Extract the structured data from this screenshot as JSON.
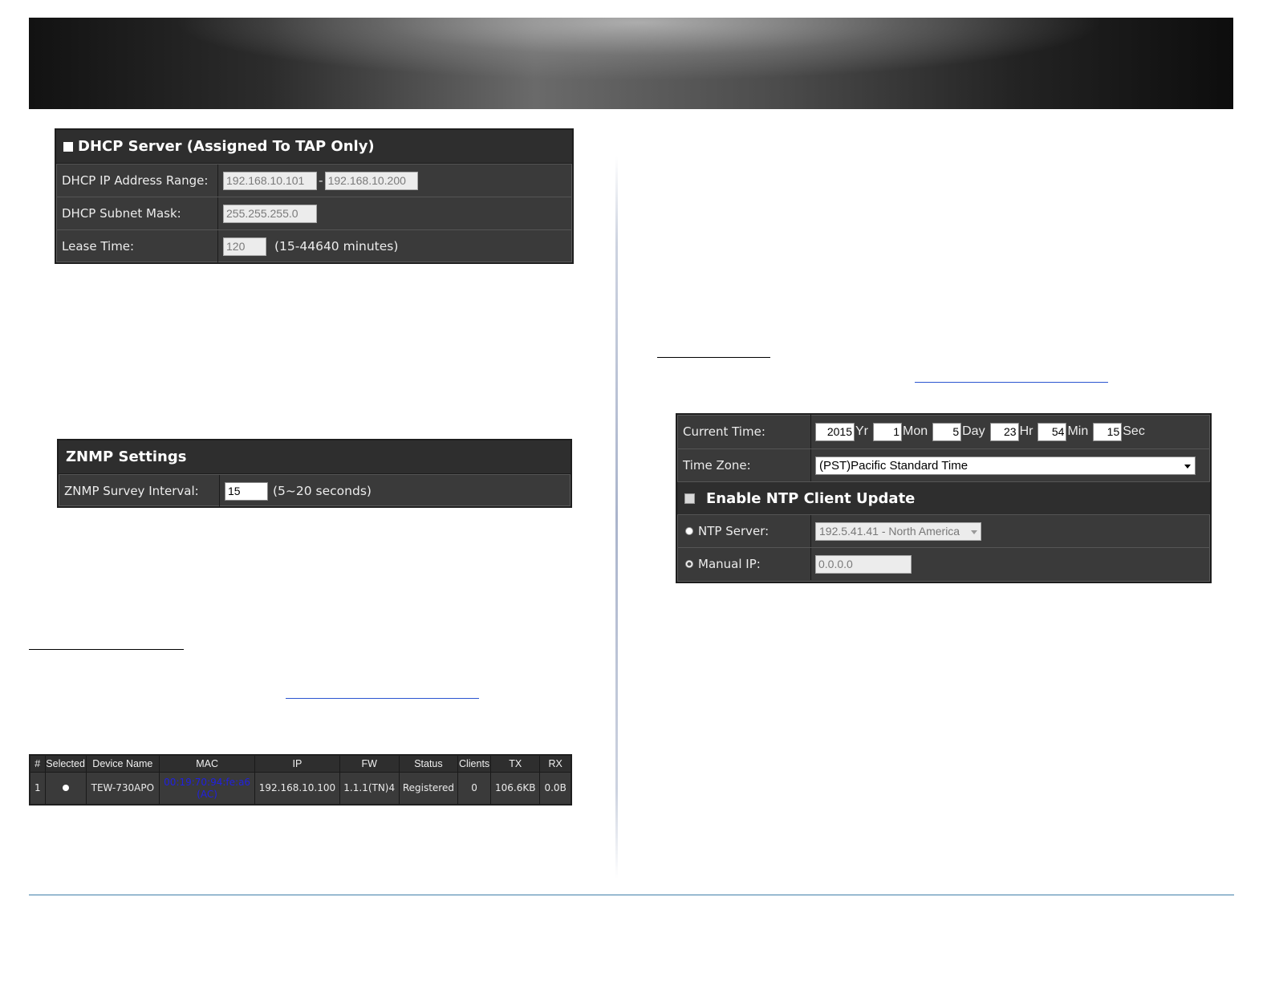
{
  "dhcp": {
    "title": "DHCP Server (Assigned To TAP Only)",
    "range_label": "DHCP IP Address Range:",
    "range_start": "192.168.10.101",
    "range_sep": "-",
    "range_end": "192.168.10.200",
    "mask_label": "DHCP Subnet Mask:",
    "mask_value": "255.255.255.0",
    "lease_label": "Lease Time:",
    "lease_value": "120",
    "lease_hint": "(15-44640 minutes)"
  },
  "znmp": {
    "title": "ZNMP Settings",
    "interval_label": "ZNMP Survey Interval:",
    "interval_value": "15",
    "interval_hint": "(5~20 seconds)"
  },
  "devices": {
    "headers": [
      "#",
      "Selected",
      "Device Name",
      "MAC",
      "IP",
      "FW",
      "Status",
      "Clients",
      "TX",
      "RX"
    ],
    "rows": [
      {
        "num": "1",
        "device_name": "TEW-730APO",
        "mac": "00:19:70:94:fe:a6",
        "mac_note": "(AC)",
        "ip": "192.168.10.100",
        "fw": "1.1.1(TN)4",
        "status": "Registered",
        "clients": "0",
        "tx": "106.6KB",
        "rx": "0.0B"
      }
    ]
  },
  "time": {
    "current_label": "Current Time:",
    "year": "2015",
    "year_unit": "Yr",
    "month": "1",
    "month_unit": "Mon",
    "day": "5",
    "day_unit": "Day",
    "hour": "23",
    "hour_unit": "Hr",
    "minute": "54",
    "minute_unit": "Min",
    "second": "15",
    "second_unit": "Sec",
    "zone_label": "Time Zone:",
    "zone_value": "(PST)Pacific Standard Time",
    "ntp_title": "Enable NTP Client Update",
    "ntp_server_label": "NTP Server:",
    "ntp_server_value": "192.5.41.41 - North America",
    "manual_ip_label": "Manual IP:",
    "manual_ip_value": "0.0.0.0"
  }
}
